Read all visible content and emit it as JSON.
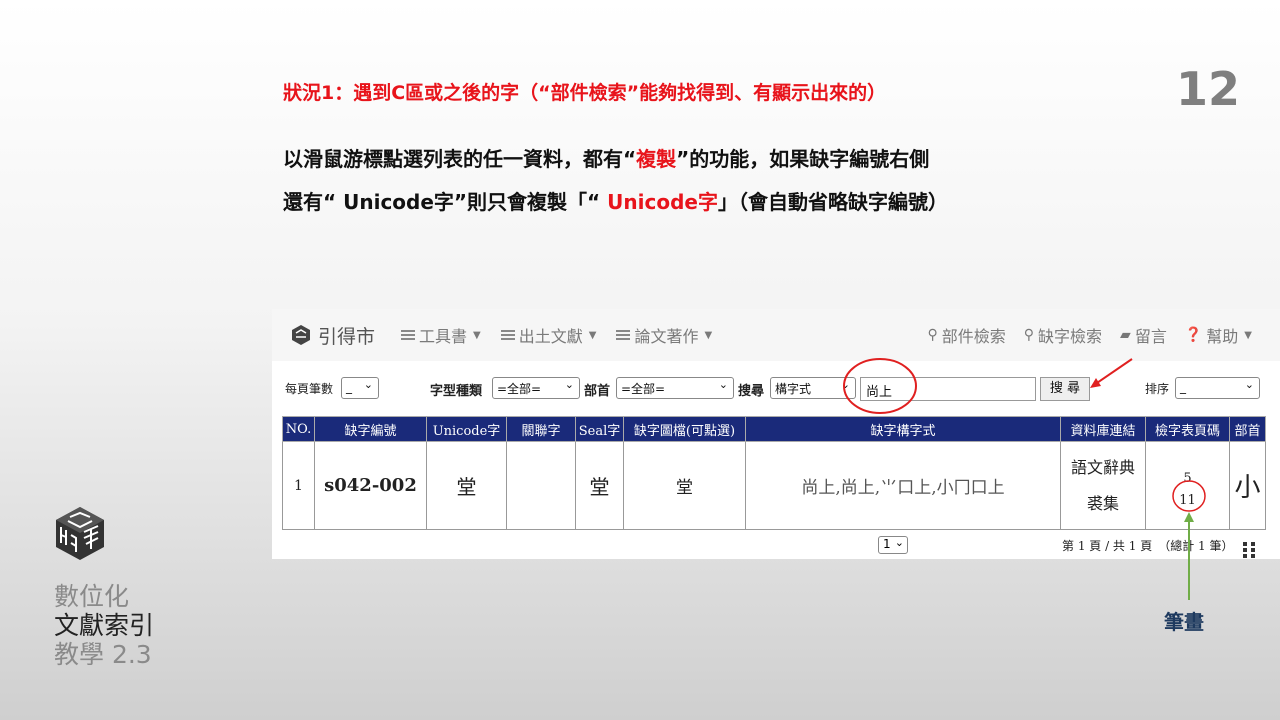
{
  "slide": {
    "title": "狀況1：遇到C區或之後的字（“部件檢索”能夠找得到、有顯示出來的）",
    "number": "12",
    "line1_a": "以滑鼠游標點選列表的任一資料，都有“",
    "line1_red": "複製",
    "line1_b": "”的功能，如果缺字編號右側",
    "line2_a": "還有“ Unicode字”則只會複製「“ ",
    "line2_red": "Unicode字",
    "line2_b": "」（會自動省略缺字編號）"
  },
  "brand": {
    "line1": "數位化",
    "line2": "文獻索引",
    "line3": "教學 2.3"
  },
  "nav": {
    "site_name": "引得市",
    "items": [
      "工具書",
      "出土文獻",
      "論文著作"
    ],
    "right": [
      "部件檢索",
      "缺字檢索",
      "留言",
      "幫助"
    ]
  },
  "search": {
    "per_page_label": "每頁筆數",
    "per_page_value": "_",
    "type_label": "字型種類",
    "type_value": "=全部=",
    "radical_label": "部首",
    "radical_value": "=全部=",
    "search_label": "搜尋",
    "search_by": "構字式",
    "query": "尚上",
    "button": "搜 尋",
    "sort_label": "排序",
    "sort_value": "_"
  },
  "table": {
    "headers": [
      "NO.",
      "缺字編號",
      "Unicode字",
      "關聯字",
      "Seal字",
      "缺字圖檔(可點選)",
      "缺字構字式",
      "資料庫連結",
      "檢字表頁碼",
      "部首"
    ],
    "row": {
      "no": "1",
      "code": "s042-002",
      "unicode": "堂",
      "related": "",
      "seal": "堂",
      "image": "堂",
      "formula": "尚上,尚上,⺌口上,小冂口上",
      "db_link1": "語文辭典",
      "db_link2": "裘集",
      "page_top": "5",
      "page_bottom": "11",
      "radical": "小"
    }
  },
  "pager": {
    "value": "1",
    "info": "第 1 頁 / 共 1 頁　（總計 1 筆）"
  },
  "annotation": "筆畫",
  "colors": {
    "accent_red": "#e8141b",
    "header_navy": "#1a2a7a",
    "annot_green": "#70ad47"
  }
}
